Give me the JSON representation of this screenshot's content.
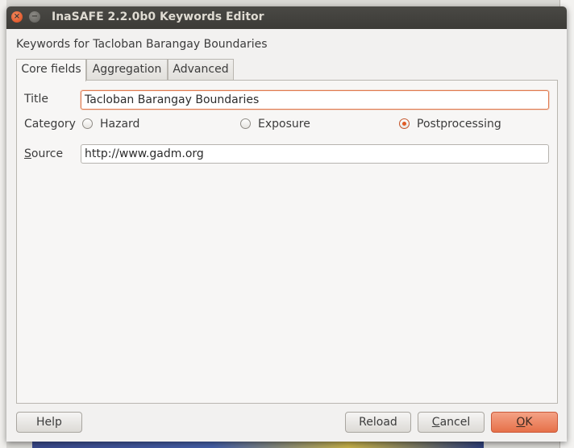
{
  "window": {
    "title": "InaSAFE 2.2.0b0 Keywords Editor",
    "close_glyph": "×",
    "minimize_glyph": "−"
  },
  "heading": "Keywords for Tacloban Barangay Boundaries",
  "tabs": [
    {
      "label": "Core fields",
      "active": true
    },
    {
      "label": "Aggregation",
      "active": false
    },
    {
      "label": "Advanced",
      "active": false
    }
  ],
  "core": {
    "title_label": "Title",
    "title_value": "Tacloban Barangay Boundaries",
    "category_label": "Category",
    "categories": [
      {
        "label": "Hazard",
        "checked": false
      },
      {
        "label": "Exposure",
        "checked": false
      },
      {
        "label": "Postprocessing",
        "checked": true
      }
    ],
    "source_label_first": "S",
    "source_label_rest": "ource",
    "source_value": "http://www.gadm.org"
  },
  "buttons": {
    "help": "Help",
    "reload": "Reload",
    "cancel_first": "C",
    "cancel_rest": "ancel",
    "ok_first": "O",
    "ok_rest": "K"
  },
  "colors": {
    "accent": "#e67049",
    "titlebar": "#3c3b37"
  }
}
